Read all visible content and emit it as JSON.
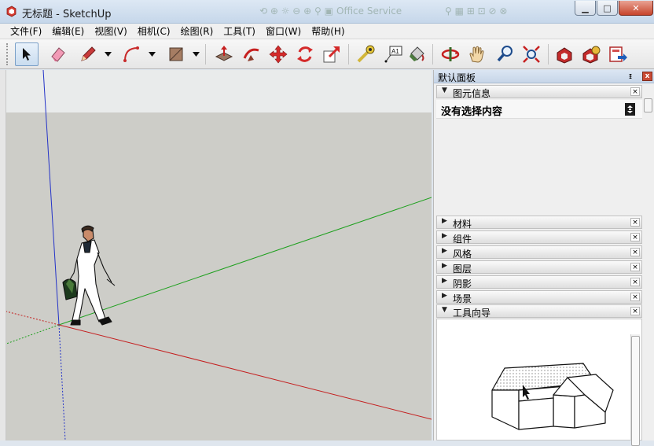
{
  "window": {
    "title": "无标题 - SketchUp",
    "background_tab_text": "Office Service",
    "buttons": {
      "minimize": "▁",
      "maximize": "□",
      "close": "✕"
    }
  },
  "menu": [
    {
      "label": "文件(F)"
    },
    {
      "label": "编辑(E)"
    },
    {
      "label": "视图(V)"
    },
    {
      "label": "相机(C)"
    },
    {
      "label": "绘图(R)"
    },
    {
      "label": "工具(T)"
    },
    {
      "label": "窗口(W)"
    },
    {
      "label": "帮助(H)"
    }
  ],
  "toolbar": {
    "tools": [
      "select",
      "eraser",
      "pencil",
      "arc",
      "shape",
      "push-pull",
      "follow-me",
      "move",
      "rotate",
      "scale",
      "tape-measure",
      "text",
      "paint-bucket",
      "orbit",
      "pan",
      "zoom",
      "zoom-extents",
      "3d-warehouse",
      "extension-warehouse",
      "send-to-layout"
    ],
    "text_tool_glyph": "A1",
    "active_tool": "select"
  },
  "tray": {
    "title": "默认面板",
    "pin_glyph": "ᵻ",
    "close_glyph": "x",
    "entity_info": {
      "label": "图元信息",
      "status": "没有选择内容",
      "expanded": true
    },
    "sections": [
      {
        "label": "材料"
      },
      {
        "label": "组件"
      },
      {
        "label": "风格"
      },
      {
        "label": "图层"
      },
      {
        "label": "阴影"
      },
      {
        "label": "场景"
      }
    ],
    "instructor": {
      "label": "工具向导",
      "expanded": true
    },
    "collapse_glyph": "▼",
    "expand_glyph": "▶",
    "section_close_glyph": "×"
  },
  "colors": {
    "axis_red": "#cc2222",
    "axis_green": "#22aa22",
    "axis_blue": "#2222cc",
    "sky": "#e9ebeb",
    "ground": "#cdcdc8",
    "title_bar": "#c6d7ea"
  }
}
